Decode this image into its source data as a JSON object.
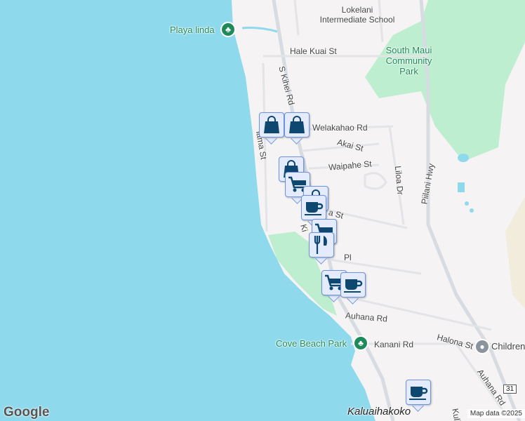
{
  "map": {
    "pois": {
      "playa_linda": "Playa linda",
      "school": "Lokelani Intermediate School",
      "park": "South Maui Community Park",
      "cove_beach": "Cove Beach Park",
      "children": "Children",
      "place": "Kaluaihakoko"
    },
    "streets": {
      "hale_kuai": "Hale Kuai St",
      "s_kihei": "S Kihei Rd",
      "welakahao": "Welakahao Rd",
      "akai": "Akai St",
      "waipahe": "Waipahe St",
      "liloa": "Liloa Dr",
      "piilani": "Piilani Hwy",
      "alahama": "lama St",
      "kulanihakoi": "a St",
      "kihei_partial": "Ki",
      "pl": "Pl",
      "auhana": "Auhana Rd",
      "halona": "Halona St",
      "kanani": "Kanani Rd",
      "auhana2": "Auhana Rd",
      "kuli": "Kuli"
    },
    "highway_shield": "31",
    "markers": [
      "shopping-bag",
      "shopping-bag",
      "shopping-bag",
      "shopping-cart",
      "shopping-bag",
      "coffee",
      "shopping-cart",
      "restaurant",
      "shopping-cart",
      "coffee",
      "coffee"
    ],
    "colors": {
      "water": "#8fd9ec",
      "land": "#f5f3f3",
      "park": "#bdeecf",
      "marker_bg": "#e3ebfc",
      "marker_icon": "#0e4870"
    }
  },
  "footer": {
    "logo": "Google",
    "attribution": "Map data ©2025"
  }
}
